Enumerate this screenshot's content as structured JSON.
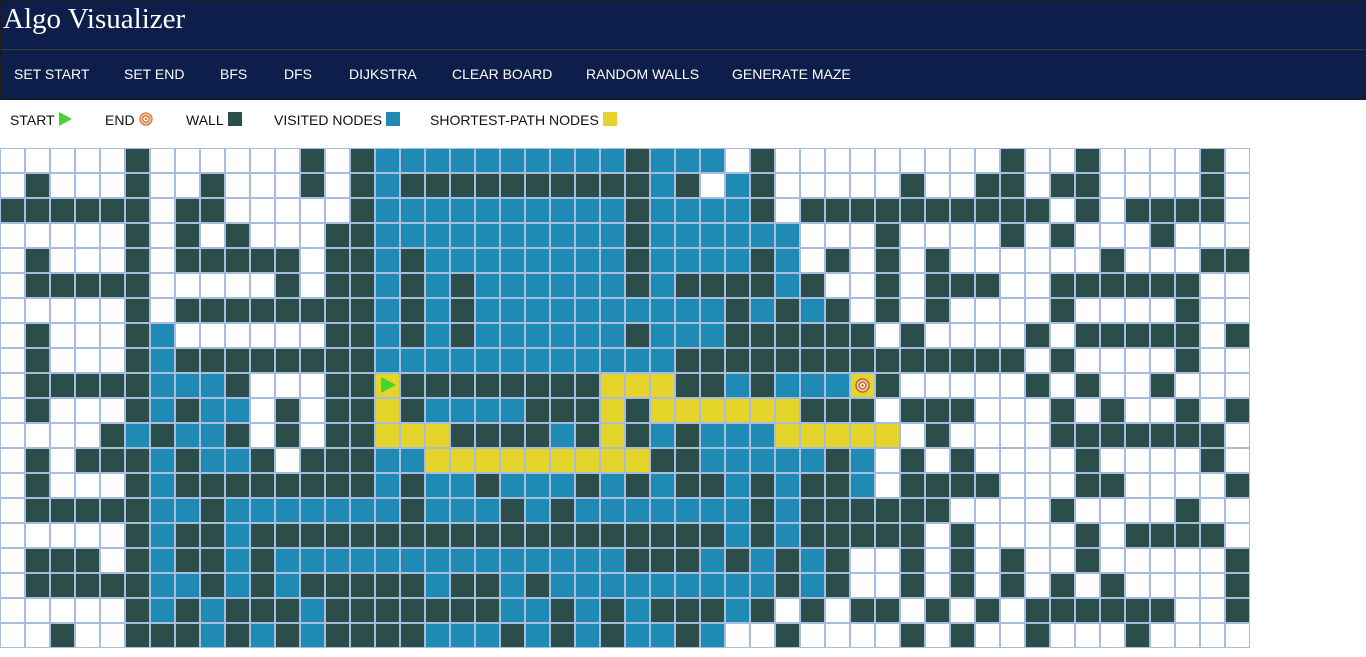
{
  "app": {
    "title": "Algo Visualizer"
  },
  "toolbar": {
    "buttons": [
      {
        "label": "SET START"
      },
      {
        "label": "SET END"
      },
      {
        "label": "BFS"
      },
      {
        "label": "DFS"
      },
      {
        "label": "DIJKSTRA"
      },
      {
        "label": "CLEAR BOARD"
      },
      {
        "label": "RANDOM WALLS"
      },
      {
        "label": "GENERATE MAZE"
      }
    ]
  },
  "legend": {
    "start": "START",
    "end": "END",
    "wall": "WALL",
    "visited": "VISITED NODES",
    "path": "SHORTEST-PATH NODES"
  },
  "colors": {
    "header_bg": "#0e1e4a",
    "wall": "#2b4e4a",
    "visited": "#1f8bb4",
    "path": "#e5d52a",
    "start": "#44d62c",
    "end": "#d9782b",
    "grid_line": "#a7bde0"
  },
  "board": {
    "cols": 50,
    "rows": 20,
    "legend_key": {
      ".": "empty",
      "W": "wall",
      "V": "visited",
      "P": "shortest-path",
      "S": "start",
      "E": "end"
    },
    "cells": [
      ".....W......W.WVVVVVVVVVVWVVV.W.........W..W....W.",
      ".W...W..W...W.WVWWWWWWWWWWVW.VW.....W..WW.WW....W.",
      "WWWWWW.WW.....WVVVVVVVVVVWVVVVW.WWWWWWWWWW.W.WWWW.WW",
      ".....W.W.W...WWVVVVVVVVVVWVVVVVV...W....W.W...W...",
      ".W...W.WWWWW.WWVWVVVVVVVVWVVVVWV.W.W.W......W...WWWW",
      ".WWWWW.....W.WWVWVWVVVVVVWVWWWWVW..W.WWW..WWWWWW...",
      ".....W.WWWWWWWWVWVWVVVVVVVVVVWVWVW.W.W....W....W...",
      ".W...WV......WWVWVWVVVVVVWVVVWWWWWW.W....W.WWWWW.WW",
      ".W...WVWWWWWWWWVVVVVVVVVVVVWWWWWWWWWWWWWW.W....W...",
      ".WWWWWVVVW...WWSWWWWWWWWPPPWWVWVVVEW.....W.W..W...",
      ".W...WVWVV.W.WWPWVVVVWWWPWPPPPPPWWW.WWW...W.W..W.WW",
      "....WVWVVW.W.WWPPPWWWWVWPWVWVVVPPPPP.W....WWWWWWW..",
      ".W.WWWVWVVW.WWWVVPPPPPPPPPWWVVVVVWV.W.W....W....W..",
      ".W...WVWWWWWWWWVWVVWVVVWVWVWWVWVWWV.WWWW...WW....W..",
      ".WWWWWVVWVVVVVVVWVVVWVWVVVVVVVWVWWWWWW....W....W..",
      ".....WVWWVWWWWWWWWWWWWWWWWWWWVWVWWWWW.W....W.WWWW..",
      ".WWW.WVWWVWVVVVVVVVVVVVVVWWWVWVWVW..W.W.W..W.....WW",
      ".WWWWWVVWVWVWWWWWVWWVWVVVVVVVVVWVW..W.W.W.W.W....W..",
      ".....WVWVWWWVWWWWWWWVVWVWVWWWVW.W.WW.W.W.WWWWWW..W..",
      "..W..WWWVWVWVWWWWVVVWVWVWVVWV..W....W.W..W...W..."
    ]
  }
}
